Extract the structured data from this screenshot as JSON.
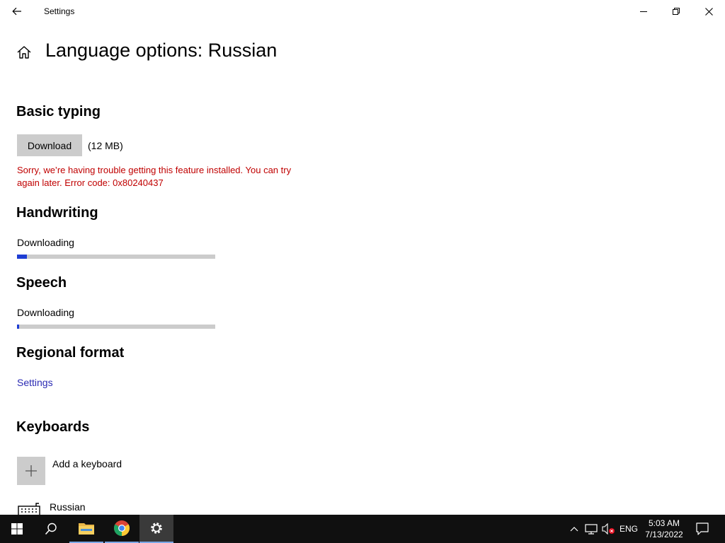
{
  "window": {
    "title": "Settings"
  },
  "page": {
    "title": "Language options: Russian"
  },
  "basic_typing": {
    "heading": "Basic typing",
    "download_label": "Download",
    "size": "(12 MB)",
    "error_line1": "Sorry, we’re having trouble getting this feature installed. You can try",
    "error_line2": "again later. Error code: 0x80240437"
  },
  "handwriting": {
    "heading": "Handwriting",
    "status": "Downloading",
    "progress": 0.05
  },
  "speech": {
    "heading": "Speech",
    "status": "Downloading",
    "progress": 0.01
  },
  "regional_format": {
    "heading": "Regional format",
    "link": "Settings"
  },
  "keyboards": {
    "heading": "Keyboards",
    "add_label": "Add a keyboard",
    "items": [
      {
        "label": "Russian"
      }
    ]
  },
  "taskbar": {
    "language": "ENG",
    "time": "5:03 AM",
    "date": "7/13/2022"
  },
  "colors": {
    "error": "#c00000",
    "link": "#2a2ab3",
    "progress": "#1e3dd3",
    "taskbar": "#101010"
  }
}
